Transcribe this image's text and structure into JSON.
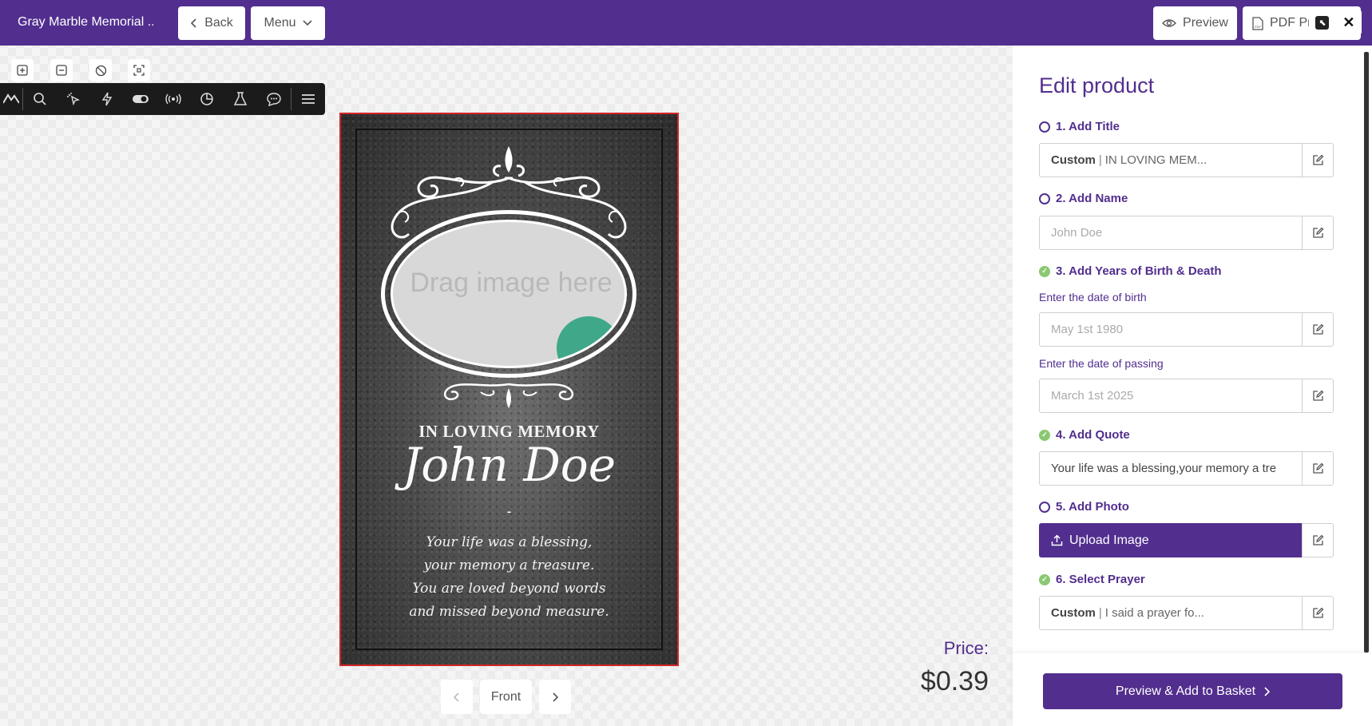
{
  "header": {
    "title": "Gray Marble Memorial ...",
    "back_label": "Back",
    "menu_label": "Menu",
    "preview_label": "Preview",
    "pdf_label": "PDF Pr"
  },
  "card": {
    "photo_placeholder": "Drag image here",
    "heading": "IN LOVING MEMORY",
    "name": "John Doe",
    "dash": "-",
    "quote_lines": [
      "Your life was a blessing,",
      "your memory a treasure.",
      "You are loved beyond words",
      "and missed beyond measure."
    ]
  },
  "pager": {
    "prev": "‹",
    "side_label": "Front",
    "next": "›"
  },
  "price": {
    "label": "Price:",
    "value": "$0.39"
  },
  "panel": {
    "title": "Edit product",
    "steps": {
      "title": {
        "label": "1. Add Title",
        "prefix": "Custom",
        "value": "IN LOVING MEM..."
      },
      "name": {
        "label": "2. Add Name",
        "placeholder": "John Doe"
      },
      "years": {
        "label": "3. Add Years of Birth & Death",
        "birth_label": "Enter the date of birth",
        "birth_placeholder": "May 1st 1980",
        "passing_label": "Enter the date of passing",
        "passing_placeholder": "March 1st 2025"
      },
      "quote": {
        "label": "4. Add Quote",
        "value": "Your life was a blessing,your memory a tre"
      },
      "photo": {
        "label": "5. Add Photo",
        "button": "Upload Image"
      },
      "prayer": {
        "label": "6. Select Prayer",
        "prefix": "Custom",
        "value": "I said a prayer fo..."
      }
    },
    "cta": "Preview & Add to Basket"
  },
  "colors": {
    "brand": "#522e8e",
    "done": "#8bc872",
    "card_border": "#d32626"
  }
}
